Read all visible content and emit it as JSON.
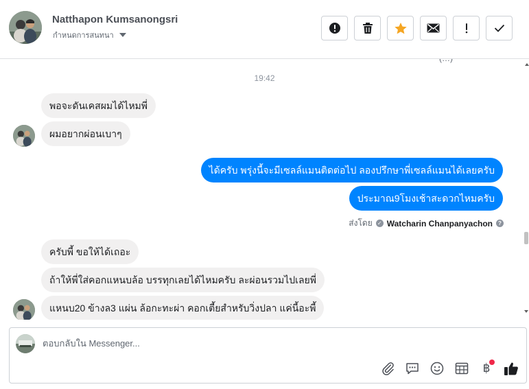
{
  "header": {
    "contact_name": "Natthapon Kumsanongsri",
    "assign_label": "กำหนดการสนทนา",
    "actions": [
      {
        "icon": "alert-circle-icon",
        "name": "mark-spam-button"
      },
      {
        "icon": "trash-icon",
        "name": "delete-button"
      },
      {
        "icon": "star-icon",
        "name": "star-button",
        "color": "#f5a623"
      },
      {
        "icon": "envelope-icon",
        "name": "mark-unread-button"
      },
      {
        "icon": "exclamation-icon",
        "name": "follow-up-button"
      },
      {
        "icon": "checkmark-icon",
        "name": "mark-done-button"
      }
    ]
  },
  "conversation": {
    "clipped_top_text": "(…)",
    "timestamp": "19:42",
    "messages": [
      {
        "from": "customer",
        "text": "พอจะดันเคสผมได้ไหมพี่"
      },
      {
        "from": "customer",
        "text": "ผมอยากผ่อนเบาๆ"
      },
      {
        "from": "page",
        "text": "ได้ครับ พรุ่งนี้จะมีเซลล์แมนติดต่อไป ลองปรึกษาพี่เซลล์แมนได้เลยครับ"
      },
      {
        "from": "page",
        "text": "ประมาณ9โมงเช้าสะดวกไหมครับ"
      },
      {
        "from": "customer",
        "text": "ครับพี้ ขอให้ได้เถอะ"
      },
      {
        "from": "customer",
        "text": "ถ้าให้พี่ใส่คอกแหนบล้อ บรรทุกเลยได้ไหมครับ ละผ่อนรวมไปเลยพี่"
      },
      {
        "from": "customer",
        "text": "แหนบ20 ข้างล3 แผ่น  ล้อกะทะผ่า คอกเตี้ยสำหรับวิ่งปลา  แค่นี้อะพี้"
      }
    ],
    "sent_by_label": "ส่งโดย",
    "sent_by_agent": "Watcharin Chanpanyachon"
  },
  "composer": {
    "placeholder": "ตอบกลับใน Messenger...",
    "value": "",
    "tools": [
      "paperclip-icon",
      "saved-reply-icon",
      "emoji-icon",
      "appointment-icon",
      "payment-baht-icon",
      "thumbs-up-icon"
    ],
    "baht_symbol": "฿"
  },
  "colors": {
    "outgoing_bubble": "#0084ff",
    "incoming_bubble": "#f1f0f0",
    "star": "#f5a623",
    "notification_dot": "#f02849"
  }
}
